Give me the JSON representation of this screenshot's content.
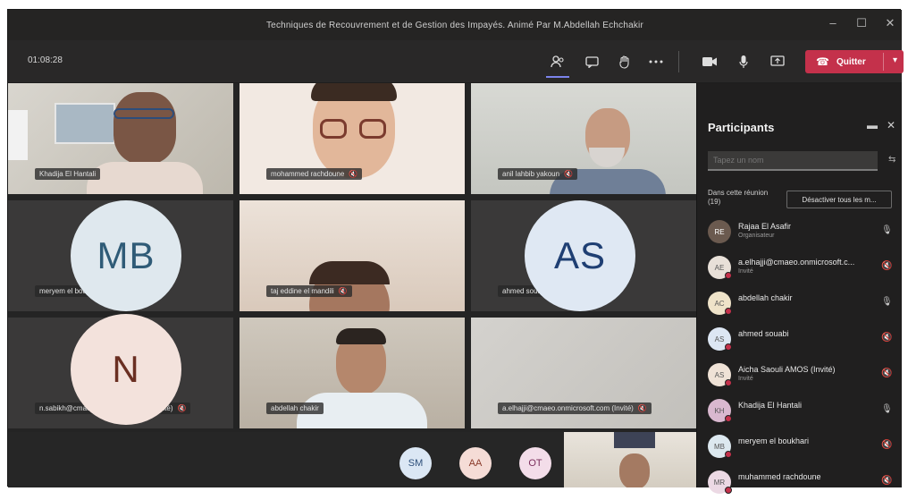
{
  "window": {
    "title": "Techniques de Recouvrement et de Gestion des Impayés. Animé Par M.Abdellah Echchakir",
    "controls": [
      "–",
      "☐",
      "✕"
    ]
  },
  "toolbar": {
    "timer": "01:08:28",
    "icons": [
      "participants-icon",
      "chat-icon",
      "raise-hand-icon",
      "more-icon",
      "camera-icon",
      "mic-icon",
      "share-icon"
    ],
    "leave_label": "Quitter",
    "leave_color": "#c4314b"
  },
  "tiles": [
    {
      "name": "Khadija El Hantali",
      "mic": false
    },
    {
      "name": "mohammed rachdoune",
      "mic": true
    },
    {
      "name": "anil lahbib yakoun",
      "mic": true
    },
    {
      "name": "meryem el boukhari",
      "mic": true,
      "initials": "MB"
    },
    {
      "name": "taj eddine el mandili",
      "mic": true
    },
    {
      "name": "ahmed souabi",
      "mic": true,
      "initials": "AS"
    },
    {
      "name": "n.sabikh@cmaeo.onmicrosoft.com (Invité)",
      "mic": true,
      "initials": "N"
    },
    {
      "name": "abdellah chakir",
      "mic": false
    },
    {
      "name": "a.elhajji@cmaeo.onmicrosoft.com (Invité)",
      "mic": true
    }
  ],
  "bottom_avatars": [
    "SM",
    "AA",
    "OT"
  ],
  "participants_panel": {
    "title": "Participants",
    "search_placeholder": "Tapez un nom",
    "section_label": "Dans cette réunion (19)",
    "mute_all_label": "Désactiver tous les m...",
    "items": [
      {
        "name": "Rajaa El Asafir",
        "role": "Organisateur",
        "initials": "RE",
        "mic": "🎙"
      },
      {
        "name": "a.elhajji@cmaeo.onmicrosoft.c...",
        "role": "Invité",
        "initials": "AE",
        "mic": "🔇"
      },
      {
        "name": "abdellah chakir",
        "role": "",
        "initials": "AC",
        "mic": "🎙"
      },
      {
        "name": "ahmed souabi",
        "role": "",
        "initials": "AS",
        "mic": "🔇"
      },
      {
        "name": "Aicha Saouli AMOS (Invité)",
        "role": "Invité",
        "initials": "AS",
        "mic": "🔇"
      },
      {
        "name": "Khadija El Hantali",
        "role": "",
        "initials": "KH",
        "mic": "🎙"
      },
      {
        "name": "meryem el boukhari",
        "role": "",
        "initials": "MB",
        "mic": "🔇"
      },
      {
        "name": "muhammed rachdoune",
        "role": "",
        "initials": "MR",
        "mic": "🔇"
      }
    ]
  }
}
